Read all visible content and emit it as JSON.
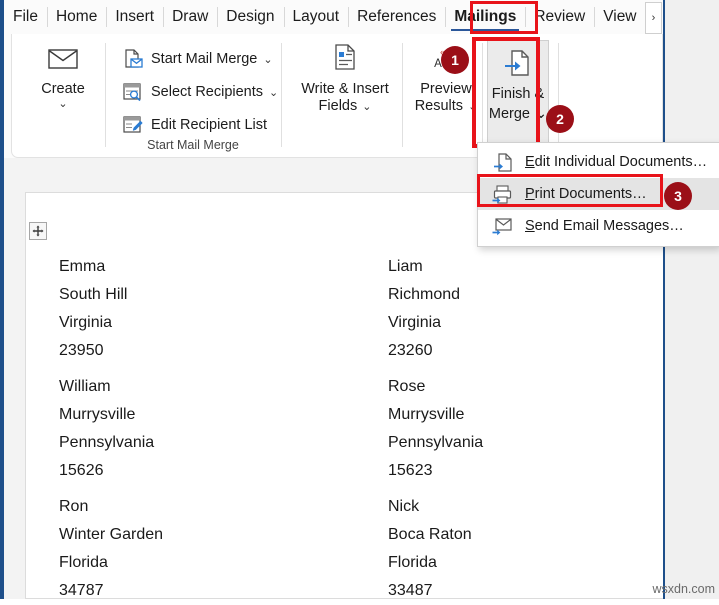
{
  "tabs": [
    {
      "label": "File",
      "active": false
    },
    {
      "label": "Home",
      "active": false
    },
    {
      "label": "Insert",
      "active": false
    },
    {
      "label": "Draw",
      "active": false
    },
    {
      "label": "Design",
      "active": false
    },
    {
      "label": "Layout",
      "active": false
    },
    {
      "label": "References",
      "active": false
    },
    {
      "label": "Mailings",
      "active": true
    },
    {
      "label": "Review",
      "active": false
    },
    {
      "label": "View",
      "active": false
    }
  ],
  "overflow_chevron": "›",
  "ribbon": {
    "create": {
      "label": "Create",
      "caret": "⌄",
      "icon": "envelope-icon"
    },
    "start_mail_merge_group": {
      "group_label": "Start Mail Merge",
      "items": [
        {
          "label": "Start Mail Merge",
          "caret": "⌄",
          "icon": "start-mail-merge-icon"
        },
        {
          "label": "Select Recipients",
          "caret": "⌄",
          "icon": "select-recipients-icon"
        },
        {
          "label": "Edit Recipient List",
          "caret": "",
          "icon": "edit-recipient-list-icon"
        }
      ]
    },
    "write_insert_fields": {
      "label_line1": "Write & Insert",
      "label_line2": "Fields",
      "caret": "⌄",
      "icon": "write-insert-fields-icon"
    },
    "preview_results": {
      "label_line1": "Preview",
      "label_line2": "Results",
      "caret": "⌄",
      "icon": "abc-preview-icon",
      "icon_text": "ABC"
    },
    "finish_merge": {
      "label_line1": "Finish &",
      "label_line2": "Merge",
      "caret": "⌄",
      "icon": "finish-merge-icon"
    }
  },
  "menu": {
    "items": [
      {
        "accel": "E",
        "rest": "dit Individual Documents…",
        "icon": "edit-documents-icon",
        "selected": false
      },
      {
        "accel": "P",
        "rest": "rint Documents…",
        "icon": "print-documents-icon",
        "selected": true
      },
      {
        "accel": "S",
        "rest": "end Email Messages…",
        "icon": "send-email-icon",
        "selected": false
      }
    ]
  },
  "badges": [
    {
      "number": "1"
    },
    {
      "number": "2"
    },
    {
      "number": "3"
    }
  ],
  "colors": {
    "highlight_red": "#e8131a",
    "badge_red": "#9b0f17",
    "tab_accent_blue": "#2b579a",
    "window_border_blue": "#1e4f8a",
    "icon_blue": "#2b7cd3"
  },
  "document": {
    "addresses": [
      {
        "name": "Emma",
        "city": "South Hill",
        "state": "Virginia",
        "zip": "23950"
      },
      {
        "name": "William",
        "city": "Murrysville",
        "state": "Pennsylvania",
        "zip": "15626"
      },
      {
        "name": "Ron",
        "city": "Winter Garden",
        "state": "Florida",
        "zip": "34787"
      },
      {
        "name": "Liam",
        "city": "Richmond",
        "state": "Virginia",
        "zip": "23260"
      },
      {
        "name": "Rose",
        "city": "Murrysville",
        "state": "Pennsylvania",
        "zip": "15623"
      },
      {
        "name": "Nick",
        "city": "Boca Raton",
        "state": "Florida",
        "zip": "33487"
      }
    ]
  },
  "watermark": "wsxdn.com"
}
